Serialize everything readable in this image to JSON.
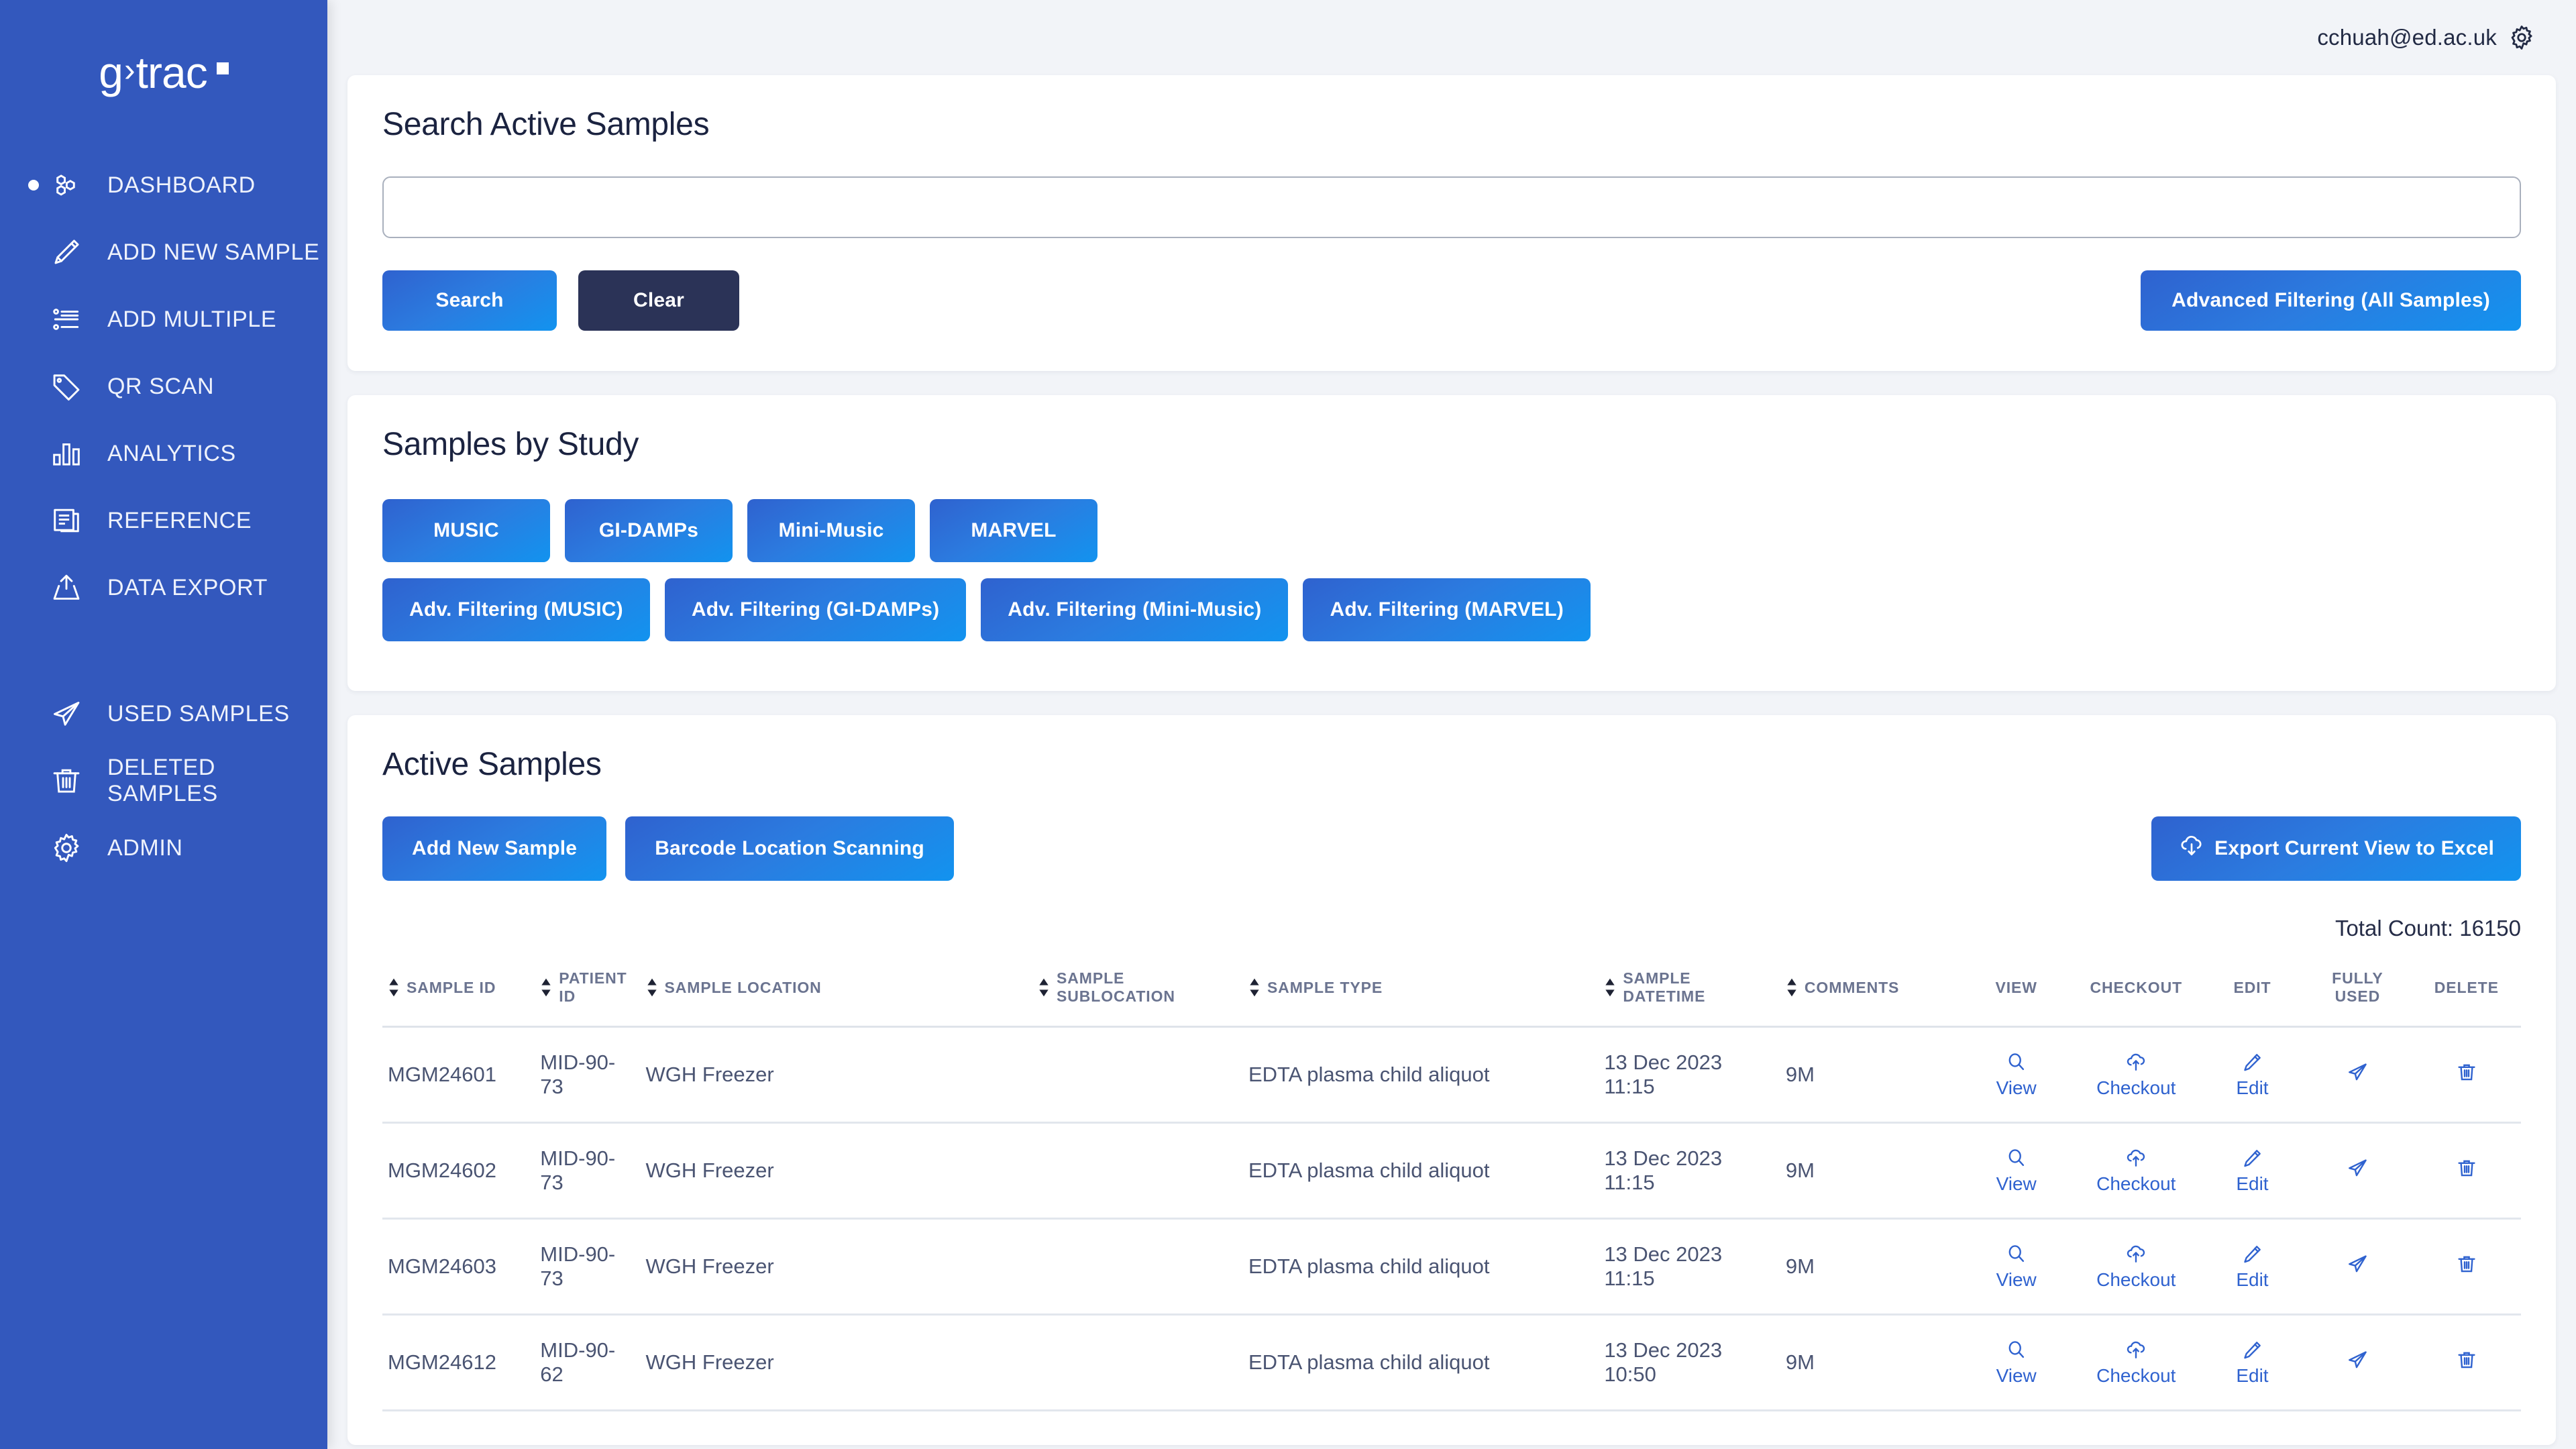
{
  "brand": {
    "text_g": "g",
    "chevron": "›",
    "text_trac": "trac"
  },
  "sidebar": {
    "items": [
      {
        "label": "DASHBOARD",
        "icon": "hexagon-cluster-icon",
        "active": true
      },
      {
        "label": "ADD NEW SAMPLE",
        "icon": "pencil-icon",
        "active": false
      },
      {
        "label": "ADD MULTIPLE",
        "icon": "list-icon",
        "active": false
      },
      {
        "label": "QR SCAN",
        "icon": "tag-icon",
        "active": false
      },
      {
        "label": "ANALYTICS",
        "icon": "bar-chart-icon",
        "active": false
      },
      {
        "label": "REFERENCE",
        "icon": "document-icon",
        "active": false
      },
      {
        "label": "DATA EXPORT",
        "icon": "upload-icon",
        "active": false
      },
      {
        "label": "USED SAMPLES",
        "icon": "paper-plane-icon",
        "active": false
      },
      {
        "label": "DELETED SAMPLES",
        "icon": "trash-icon",
        "active": false
      },
      {
        "label": "ADMIN",
        "icon": "gear-icon",
        "active": false
      }
    ]
  },
  "topbar": {
    "user_email": "cchuah@ed.ac.uk",
    "settings_icon": "gear-icon"
  },
  "search": {
    "title": "Search Active Samples",
    "input_value": "",
    "input_placeholder": "",
    "search_label": "Search",
    "clear_label": "Clear",
    "advanced_all_label": "Advanced Filtering (All Samples)"
  },
  "studies": {
    "title": "Samples by Study",
    "buttons": [
      "MUSIC",
      "GI-DAMPs",
      "Mini-Music",
      "MARVEL"
    ],
    "advanced_buttons": [
      "Adv. Filtering (MUSIC)",
      "Adv. Filtering (GI-DAMPs)",
      "Adv. Filtering (Mini-Music)",
      "Adv. Filtering (MARVEL)"
    ]
  },
  "active_samples": {
    "title": "Active Samples",
    "add_new_label": "Add New Sample",
    "barcode_label": "Barcode Location Scanning",
    "export_label": "Export Current View to Excel",
    "total_count_label": "Total Count: 16150",
    "columns": [
      {
        "key": "sample_id",
        "label": "Sample ID",
        "sortable": true,
        "align": "left"
      },
      {
        "key": "patient_id",
        "label": "Patient ID",
        "sortable": true,
        "align": "left"
      },
      {
        "key": "sample_location",
        "label": "Sample Location",
        "sortable": true,
        "align": "left"
      },
      {
        "key": "sample_sublocation",
        "label": "Sample Sublocation",
        "sortable": true,
        "align": "left"
      },
      {
        "key": "sample_type",
        "label": "Sample Type",
        "sortable": true,
        "align": "left"
      },
      {
        "key": "sample_datetime",
        "label": "Sample Datetime",
        "sortable": true,
        "align": "left"
      },
      {
        "key": "comments",
        "label": "Comments",
        "sortable": true,
        "align": "left"
      },
      {
        "key": "view",
        "label": "View",
        "sortable": false,
        "align": "center"
      },
      {
        "key": "checkout",
        "label": "Checkout",
        "sortable": false,
        "align": "center"
      },
      {
        "key": "edit",
        "label": "Edit",
        "sortable": false,
        "align": "center"
      },
      {
        "key": "fully_used",
        "label": "Fully Used",
        "sortable": false,
        "align": "center"
      },
      {
        "key": "delete",
        "label": "Delete",
        "sortable": false,
        "align": "center"
      }
    ],
    "action_labels": {
      "view": "View",
      "checkout": "Checkout",
      "edit": "Edit"
    },
    "rows": [
      {
        "sample_id": "MGM24601",
        "patient_id": "MID-90-73",
        "sample_location": "WGH Freezer",
        "sample_sublocation": "",
        "sample_type": "EDTA plasma child aliquot",
        "sample_datetime": "13 Dec 2023 11:15",
        "comments": "9M"
      },
      {
        "sample_id": "MGM24602",
        "patient_id": "MID-90-73",
        "sample_location": "WGH Freezer",
        "sample_sublocation": "",
        "sample_type": "EDTA plasma child aliquot",
        "sample_datetime": "13 Dec 2023 11:15",
        "comments": "9M"
      },
      {
        "sample_id": "MGM24603",
        "patient_id": "MID-90-73",
        "sample_location": "WGH Freezer",
        "sample_sublocation": "",
        "sample_type": "EDTA plasma child aliquot",
        "sample_datetime": "13 Dec 2023 11:15",
        "comments": "9M"
      },
      {
        "sample_id": "MGM24612",
        "patient_id": "MID-90-62",
        "sample_location": "WGH Freezer",
        "sample_sublocation": "",
        "sample_type": "EDTA plasma child aliquot",
        "sample_datetime": "13 Dec 2023 10:50",
        "comments": "9M"
      }
    ]
  },
  "colors": {
    "sidebar_bg": "#3358bd",
    "accent_blue": "#2f62cf",
    "accent_blue_light": "#1293ef",
    "dark_navy": "#2b3357",
    "page_bg": "#f2f4f8",
    "text_dark": "#1b2340",
    "text_muted": "#6b7490"
  }
}
